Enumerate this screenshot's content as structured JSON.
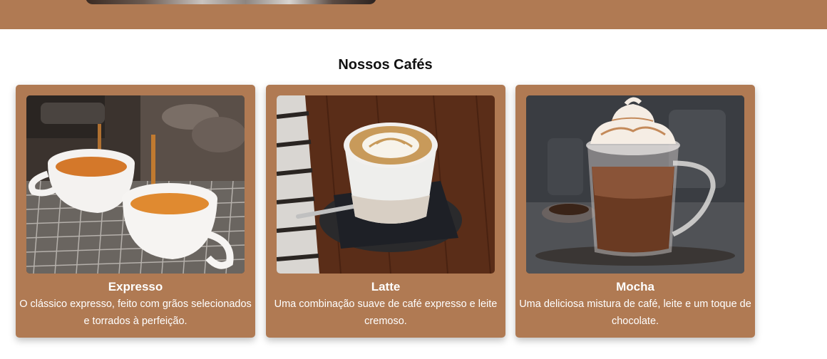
{
  "section": {
    "title": "Nossos Cafés"
  },
  "cards": [
    {
      "title": "Expresso",
      "description": "O clássico expresso, feito com grãos selecionados e torrados à perfeição.",
      "image_icon": "espresso-photo"
    },
    {
      "title": "Latte",
      "description": "Uma combinação suave de café expresso e leite cremoso.",
      "image_icon": "latte-photo"
    },
    {
      "title": "Mocha",
      "description": "Uma deliciosa mistura de café, leite e um toque de chocolate.",
      "image_icon": "mocha-photo"
    }
  ],
  "colors": {
    "card_background": "#b07a53",
    "header_band": "#b07a53",
    "card_text": "#ffffff"
  }
}
